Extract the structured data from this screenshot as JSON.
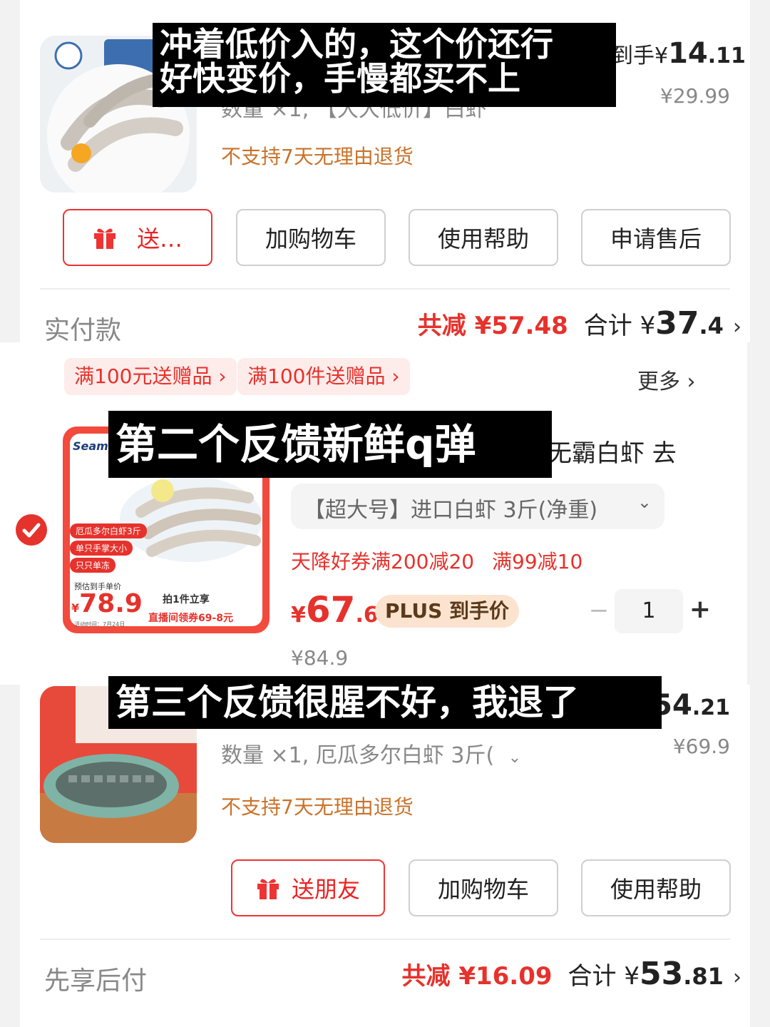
{
  "order1": {
    "net_price_label": "到手¥",
    "net_price_int": "14",
    "net_price_dec": ".11",
    "orig_price": "¥29.99",
    "qty_partial": "数量 ×1, 【大大低价】白虾",
    "return_note": "不支持7天无理由退货",
    "buttons": [
      "送…",
      "加购物车",
      "使用帮助",
      "申请售后"
    ],
    "pay_label": "实付款",
    "saved": "共减 ¥57.48",
    "total_label": "合计 ¥",
    "total_int": "37",
    "total_dec": ".4"
  },
  "cart": {
    "promo_tags": [
      "满100元送赠品 ›",
      "满100件送赠品 ›"
    ],
    "more": "更多 ›",
    "title_partial": "无霸白虾 去",
    "variant": "【超大号】进口白虾 3斤(净重)",
    "coupons": [
      "天降好券满200减20",
      "满99减10"
    ],
    "price_int": "67",
    "price_dec": ".6",
    "price_symbol": "¥",
    "plus_badge": "PLUS 到手价",
    "qty": "1",
    "minus": "−",
    "plus": "+",
    "orig_price": "¥84.9",
    "image_text": {
      "brand": "Seamix",
      "tags": [
        "厄瓜多尔白虾3斤",
        "单只手掌大小",
        "只只单冻"
      ],
      "est_label": "预估到手单价",
      "est_price": "78.9",
      "est_symbol": "¥",
      "deal": "拍1件立享",
      "live": "直播间领券69-8元",
      "date": "活动时间：7月24日"
    }
  },
  "order2": {
    "net_price_int": "54",
    "net_price_dec": ".21",
    "orig_price": "¥69.9",
    "qty_line": "数量 ×1, 厄瓜多尔白虾 3斤(",
    "return_note": "不支持7天无理由退货",
    "buttons": [
      "送朋友",
      "加购物车",
      "使用帮助"
    ],
    "pay_label": "先享后付",
    "saved": "共减 ¥16.09",
    "total_label": "合计 ¥",
    "total_int": "53",
    "total_dec": ".81"
  },
  "captions": {
    "c1_line1": "冲着低价入的，这个价还行",
    "c1_line2": "好快变价，手慢都买不上",
    "c2": "第二个反馈新鲜q弹",
    "c3": "第三个反馈很腥不好，我退了"
  },
  "colors": {
    "red": "#e6322c",
    "orange": "#c9722a",
    "grey": "#888888"
  }
}
